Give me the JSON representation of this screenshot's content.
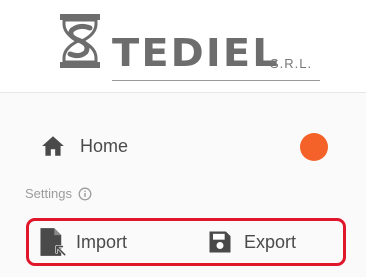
{
  "brand": {
    "name": "TEDIEL",
    "suffix": "S.R.L.",
    "logo_icon": "hourglass-s-logo"
  },
  "nav": {
    "home": {
      "label": "Home",
      "icon": "home-icon",
      "status_color": "#f4622a"
    }
  },
  "settings": {
    "header": "Settings",
    "info_icon": "info-icon",
    "actions": [
      {
        "label": "Import",
        "icon": "file-import-icon"
      },
      {
        "label": "Export",
        "icon": "save-icon"
      }
    ],
    "highlight_color": "#e0172b"
  }
}
